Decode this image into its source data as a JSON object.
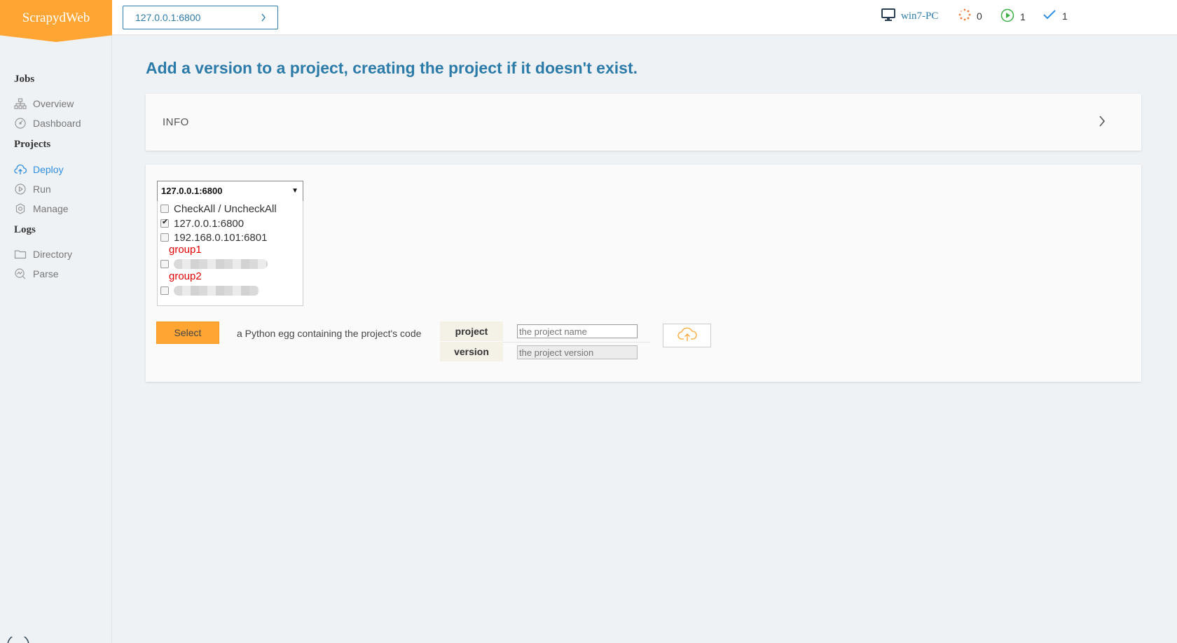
{
  "brand": "ScrapydWeb",
  "node_selector": "127.0.0.1:6800",
  "header": {
    "pc_name": "win7-PC",
    "pending_count": "0",
    "running_count": "1",
    "finished_count": "1"
  },
  "sidebar": {
    "jobs_title": "Jobs",
    "jobs": [
      {
        "label": "Overview",
        "icon": "sitemap-icon"
      },
      {
        "label": "Dashboard",
        "icon": "gauge-icon"
      }
    ],
    "projects_title": "Projects",
    "projects": [
      {
        "label": "Deploy",
        "icon": "cloud-upload-icon"
      },
      {
        "label": "Run",
        "icon": "play-circle-icon"
      },
      {
        "label": "Manage",
        "icon": "gear-icon"
      }
    ],
    "logs_title": "Logs",
    "logs": [
      {
        "label": "Directory",
        "icon": "folder-icon"
      },
      {
        "label": "Parse",
        "icon": "chart-icon"
      }
    ]
  },
  "page_title": "Add a version to a project, creating the project if it doesn't exist.",
  "info_label": "INFO",
  "deploy": {
    "node_select_value": "127.0.0.1:6800",
    "options": [
      {
        "label": "CheckAll / UncheckAll",
        "checked": false
      },
      {
        "label": "127.0.0.1:6800",
        "checked": true
      },
      {
        "label": "192.168.0.101:6801",
        "checked": false
      }
    ],
    "group1": "group1",
    "group2": "group2",
    "select_button": "Select",
    "egg_description": "a Python egg containing the project's code",
    "project_label": "project",
    "version_label": "version",
    "project_placeholder": "the project name",
    "version_placeholder": "the project version"
  },
  "colors": {
    "brand_orange": "#ffa534",
    "primary_blue": "#2c7ba8",
    "active_blue": "#2e8de0",
    "group_red": "#e30000"
  }
}
